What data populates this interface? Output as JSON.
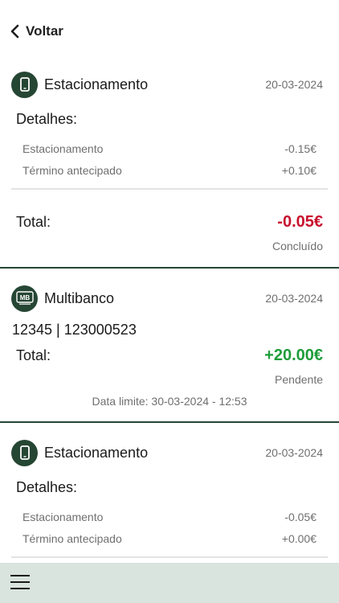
{
  "header": {
    "back_label": "Voltar"
  },
  "cards": [
    {
      "title": "Estacionamento",
      "date": "20-03-2024",
      "details_title": "Detalhes:",
      "rows": [
        {
          "label": "Estacionamento",
          "value": "-0.15€"
        },
        {
          "label": "Término antecipado",
          "value": "+0.10€"
        }
      ],
      "total_label": "Total:",
      "total_value": "-0.05€",
      "status": "Concluído"
    },
    {
      "title": "Multibanco",
      "date": "20-03-2024",
      "icon_text": "MB",
      "reference": "12345 | 123000523",
      "total_label": "Total:",
      "total_value": "+20.00€",
      "status": "Pendente",
      "deadline": "Data limite: 30-03-2024 - 12:53"
    },
    {
      "title": "Estacionamento",
      "date": "20-03-2024",
      "details_title": "Detalhes:",
      "rows": [
        {
          "label": "Estacionamento",
          "value": "-0.05€"
        },
        {
          "label": "Término antecipado",
          "value": "+0.00€"
        }
      ]
    }
  ],
  "colors": {
    "brand": "#264634",
    "negative": "#c8102e",
    "positive": "#1f9d3a",
    "bottom_bar": "#d9e4de"
  },
  "icons": [
    "chevron-left-icon",
    "phone-icon",
    "multibanco-icon",
    "menu-icon"
  ]
}
